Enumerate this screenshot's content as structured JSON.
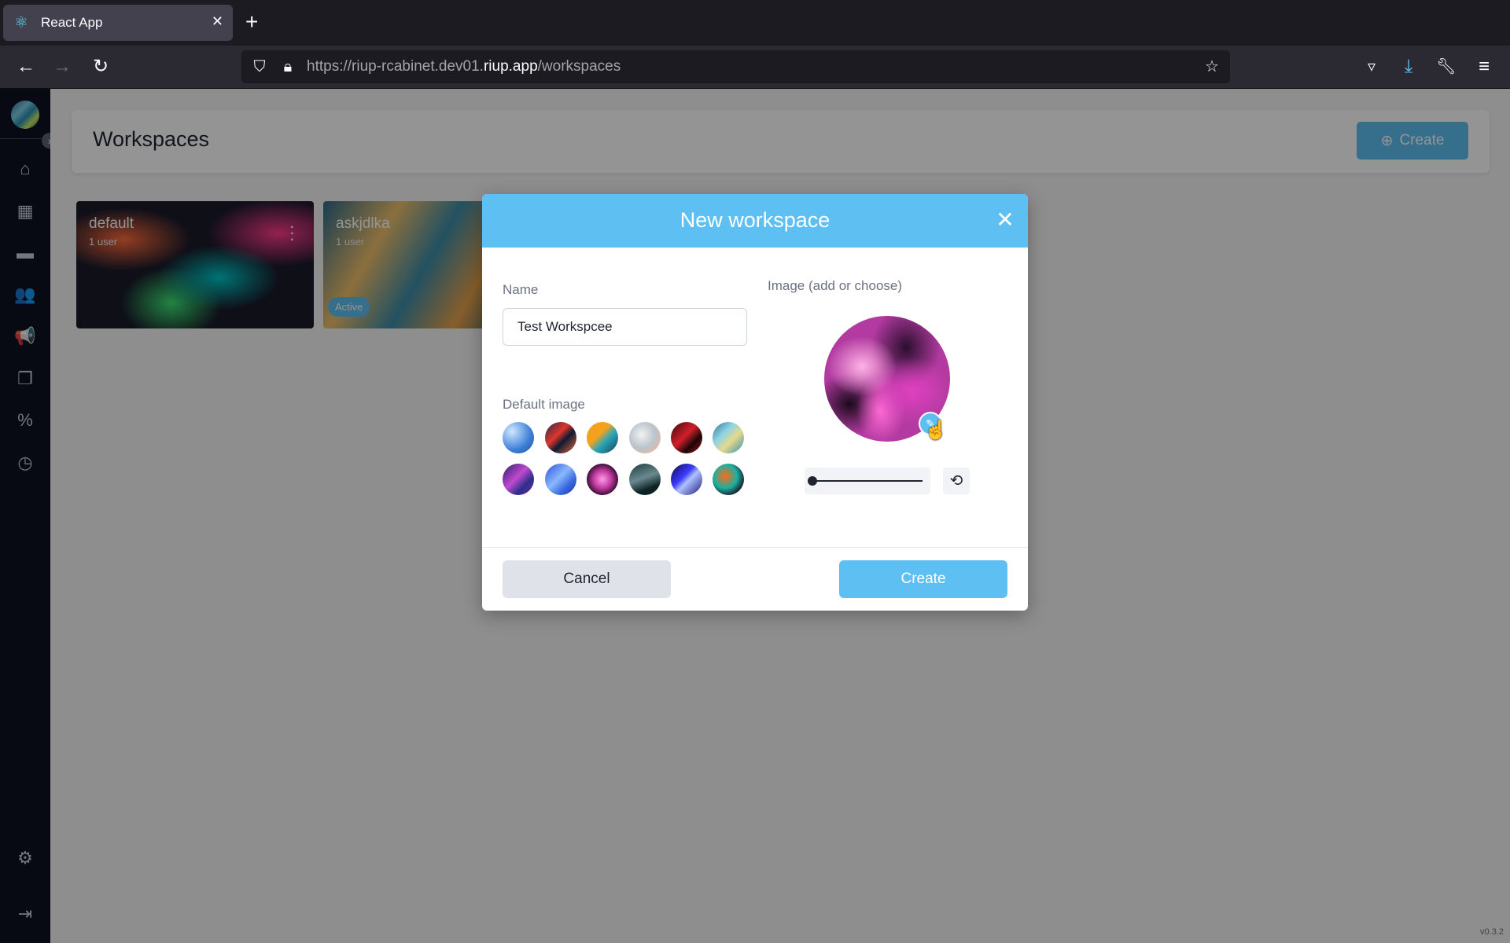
{
  "browser": {
    "tab_title": "React App",
    "tab_icon": "react-icon",
    "url_host_prefix": "https://riup-rcabinet.dev01.",
    "url_host_main": "riup.app",
    "url_path": "/workspaces"
  },
  "sidebar": {
    "items": [
      {
        "icon": "home-icon",
        "glyph": "⌂"
      },
      {
        "icon": "dashboard-icon",
        "glyph": "▦"
      },
      {
        "icon": "folder-icon",
        "glyph": "▬"
      },
      {
        "icon": "users-icon",
        "glyph": "👥"
      },
      {
        "icon": "megaphone-icon",
        "glyph": "📢"
      },
      {
        "icon": "documents-icon",
        "glyph": "❐"
      },
      {
        "icon": "percent-icon",
        "glyph": "%"
      },
      {
        "icon": "clock-icon",
        "glyph": "◷"
      }
    ],
    "bottom_items": [
      {
        "icon": "settings-icon",
        "glyph": "⚙"
      },
      {
        "icon": "logout-icon",
        "glyph": "⇥"
      }
    ]
  },
  "page": {
    "title": "Workspaces",
    "create_label": "Create",
    "version": "v0.3.2"
  },
  "workspaces": [
    {
      "name": "default",
      "users": "1 user"
    },
    {
      "name": "askjdlka",
      "users": "1 user",
      "badge": "Active"
    }
  ],
  "modal": {
    "title": "New workspace",
    "name_label": "Name",
    "name_value": "Test Workspcee",
    "image_label": "Image (add or choose)",
    "default_image_label": "Default image",
    "cancel_label": "Cancel",
    "create_label": "Create",
    "zoom_level": 0
  },
  "colors": {
    "accent": "#5ec0f2",
    "sidebar_bg": "#0d1220"
  }
}
